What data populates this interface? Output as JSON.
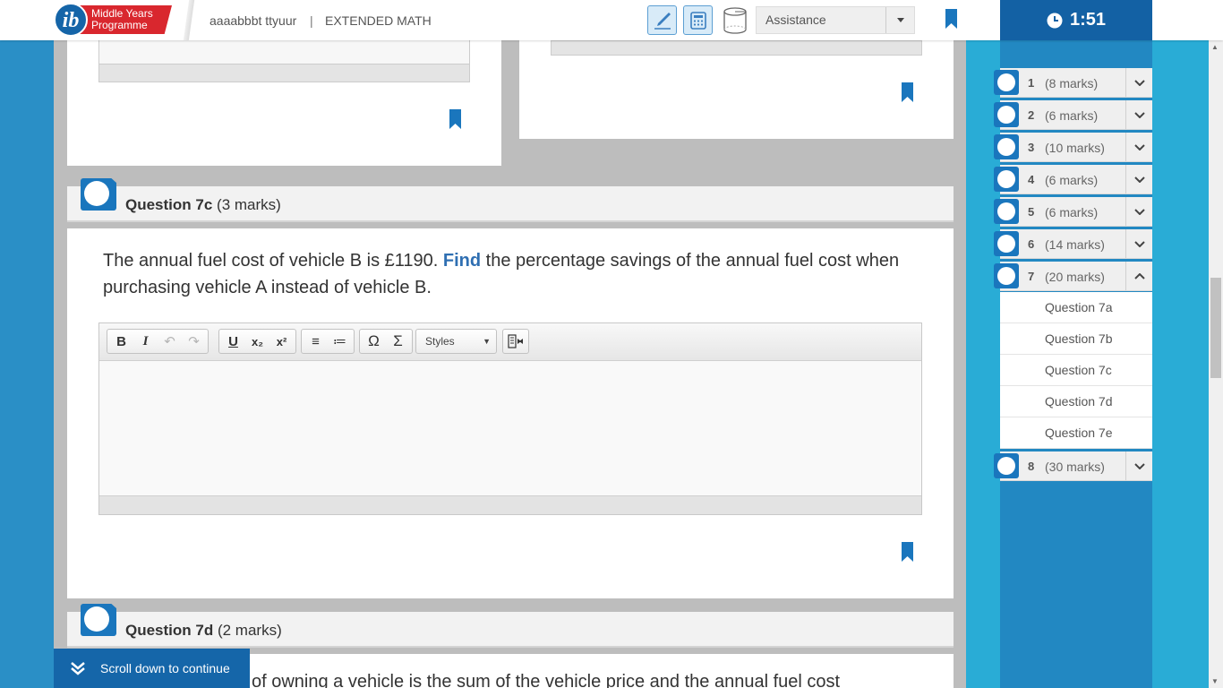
{
  "header": {
    "logo_letters": "ib",
    "logo_line1": "Middle Years",
    "logo_line2": "Programme",
    "candidate": "aaaabbbt ttyuur",
    "separator": "|",
    "subject": "EXTENDED MATH",
    "assistance_label": "Assistance"
  },
  "timer": {
    "value": "1:51"
  },
  "question_7c": {
    "label": "Question 7c",
    "marks": "(3 marks)",
    "text_before": "The annual fuel cost of vehicle B is £1190. ",
    "keyword": "Find",
    "text_after": " the percentage savings of the annual fuel cost when purchasing vehicle A instead of vehicle B."
  },
  "editor": {
    "bold": "B",
    "italic": "I",
    "undo": "↶",
    "redo": "↷",
    "underline": "U",
    "subscript": "x₂",
    "superscript": "x²",
    "ordered_list": "≡",
    "bullet_list": "≔",
    "special_char": "Ω",
    "math": "Σ",
    "styles_label": "Styles"
  },
  "question_7d": {
    "label": "Question 7d",
    "marks": "(2 marks)",
    "partial_text": "of owning a vehicle is the sum of the vehicle price and the annual fuel cost"
  },
  "scroll_prompt": "Scroll down to continue",
  "nav": {
    "questions": [
      {
        "num": "1",
        "marks": "(8 marks)"
      },
      {
        "num": "2",
        "marks": "(6 marks)"
      },
      {
        "num": "3",
        "marks": "(10 marks)"
      },
      {
        "num": "4",
        "marks": "(6 marks)"
      },
      {
        "num": "5",
        "marks": "(6 marks)"
      },
      {
        "num": "6",
        "marks": "(14 marks)"
      },
      {
        "num": "7",
        "marks": "(20 marks)"
      },
      {
        "num": "8",
        "marks": "(30 marks)"
      }
    ],
    "sub_items": [
      "Question 7a",
      "Question 7b",
      "Question 7c",
      "Question 7d",
      "Question 7e"
    ]
  },
  "colors": {
    "brand_blue": "#1361a4",
    "logo_red": "#d9272e",
    "keyword_blue": "#2f6fb2",
    "nav_strip": "#29acd6"
  }
}
